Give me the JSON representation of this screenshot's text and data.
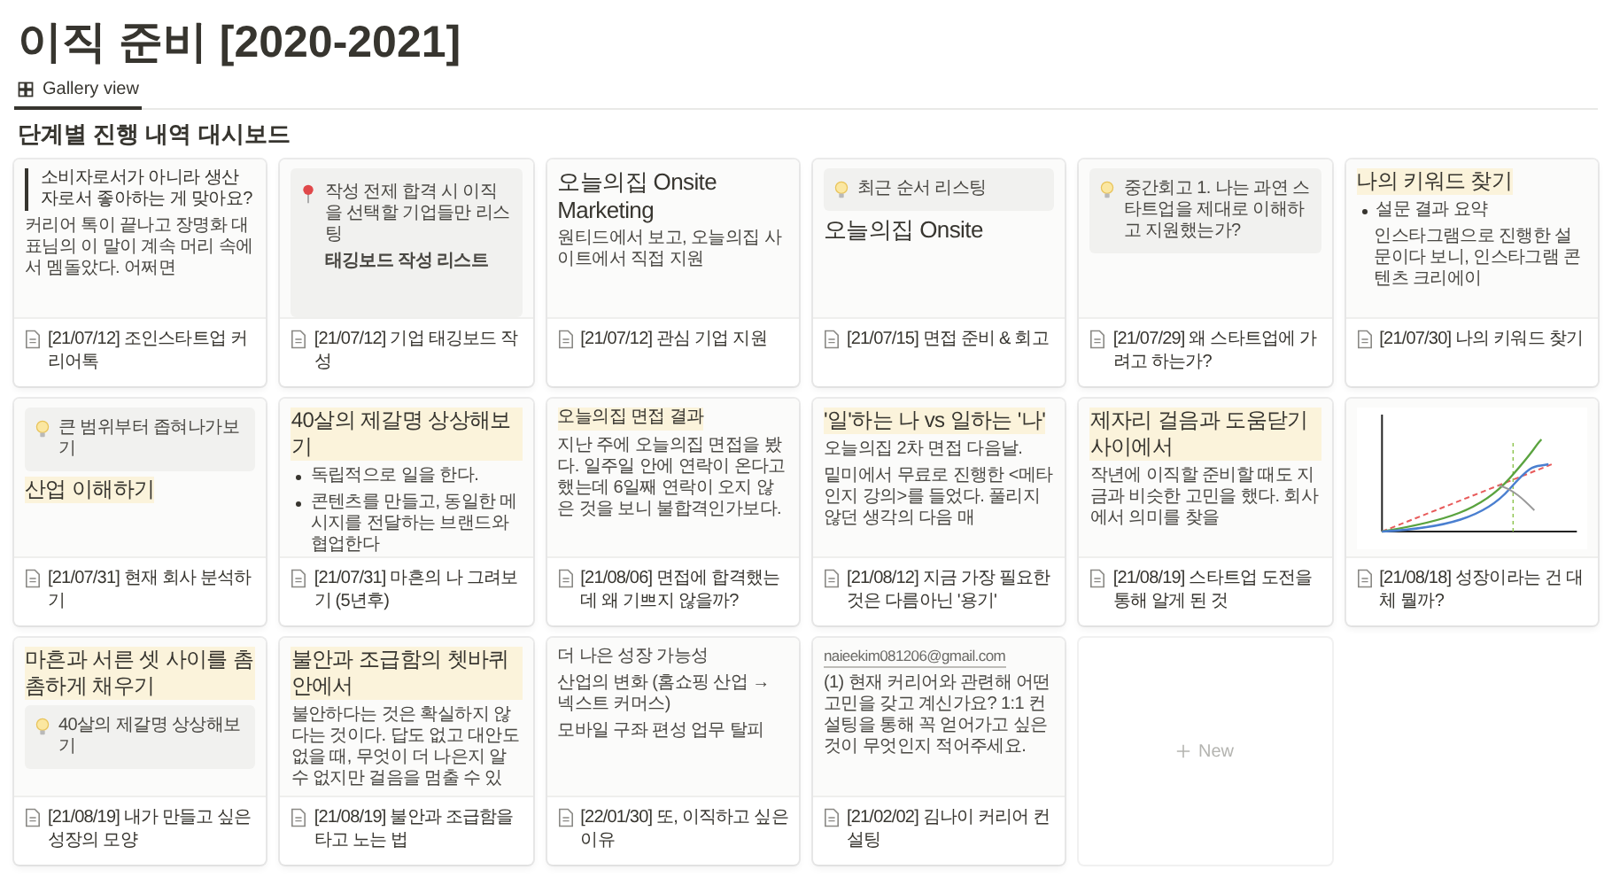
{
  "page": {
    "title": "이직 준비 [2020-2021]"
  },
  "views": [
    {
      "label": "Gallery view",
      "selected": true
    }
  ],
  "section_title": "단계별 진행 내역 대시보드",
  "cards": [
    {
      "title": "[21/07/12] 조인스타트업 커리어톡",
      "preview": [
        {
          "kind": "quote",
          "text": "소비자로서가 아니라 생산자로서 좋아하는 게 맞아요?"
        },
        {
          "kind": "para",
          "text": "커리어 톡이 끝나고 장명화 대표님의 이 말이 계속 머리 속에서 멤돌았다. 어쩌면"
        }
      ]
    },
    {
      "title": "[21/07/12] 기업 태깅보드 작성",
      "preview": [
        {
          "kind": "notice",
          "text": "작성 전제 합격 시 이직을 선택할 기업들만 리스팅",
          "subtext": "태깅보드 작성 리스트"
        }
      ]
    },
    {
      "title": "[21/07/12] 관심 기업 지원",
      "preview": [
        {
          "kind": "title",
          "text": "오늘의집 Onsite Marketing"
        },
        {
          "kind": "para",
          "text": "원티드에서 보고, 오늘의집 사이트에서 직접 지원"
        }
      ]
    },
    {
      "title": "[21/07/15] 면접 준비 & 회고",
      "preview": [
        {
          "kind": "callout",
          "text": "최근 순서 리스팅"
        },
        {
          "kind": "title",
          "text": "오늘의집 Onsite"
        }
      ]
    },
    {
      "title": "[21/07/29] 왜 스타트업에 가려고 하는가?",
      "preview": [
        {
          "kind": "callout",
          "text": "중간회고 1. 나는 과연 스타트업을 제대로 이해하고 지원했는가?"
        }
      ]
    },
    {
      "title": "[21/07/30] 나의 키워드 찾기",
      "preview": [
        {
          "kind": "heading",
          "text": "나의 키워드 찾기",
          "highlighted": true
        },
        {
          "kind": "bullet",
          "text": "설문 결과 요약"
        },
        {
          "kind": "indent",
          "text": "인스타그램으로 진행한 설문이다 보니, 인스타그램 콘텐츠 크리에이"
        }
      ]
    },
    {
      "title": "[21/07/31] 현재 회사 분석하기",
      "preview": [
        {
          "kind": "callout",
          "text": "큰 범위부터 좁혀나가보기"
        },
        {
          "kind": "heading",
          "text": "산업 이해하기",
          "highlighted": true
        }
      ]
    },
    {
      "title": "[21/07/31] 마흔의 나 그려보기 (5년후)",
      "preview": [
        {
          "kind": "heading",
          "text": "40살의 제갈명 상상해보기",
          "highlighted": true
        },
        {
          "kind": "bullet",
          "text": "독립적으로 일을 한다."
        },
        {
          "kind": "bullet",
          "text": "콘텐츠를 만들고, 동일한 메시지를 전달하는 브랜드와 협업한다"
        }
      ]
    },
    {
      "title": "[21/08/06] 면접에 합격했는데 왜 기쁘지 않을까?",
      "preview": [
        {
          "kind": "subheading",
          "text": "오늘의집 면접 결과",
          "highlighted": true
        },
        {
          "kind": "para",
          "text": "지난 주에 오늘의집 면접을 봤다. 일주일 안에 연락이 온다고 했는데 6일째 연락이 오지 않은 것을 보니 불합격인가보다."
        }
      ]
    },
    {
      "title": "[21/08/12] 지금 가장 필요한 것은 다름아닌 '용기'",
      "preview": [
        {
          "kind": "heading",
          "text": "'일'하는 나 vs 일하는 '나'",
          "highlighted": true
        },
        {
          "kind": "para",
          "text": "오늘의집 2차 면접 다음날."
        },
        {
          "kind": "para",
          "text": "밑미에서 무료로 진행한 <메타인지 강의>를 들었다. 풀리지 않던 생각의 다음 매"
        }
      ]
    },
    {
      "title": "[21/08/19] 스타트업 도전을 통해 알게 된 것",
      "preview": [
        {
          "kind": "heading",
          "text": "제자리 걸음과 도움닫기 사이에서",
          "highlighted": true
        },
        {
          "kind": "para",
          "text": "작년에 이직할 준비할 때도 지금과 비슷한 고민을 했다. 회사에서 의미를 찾을"
        }
      ]
    },
    {
      "title": "[21/08/18] 성장이라는 건 대체 뭘까?",
      "preview": [
        {
          "kind": "image"
        }
      ]
    },
    {
      "title": "[21/08/19] 내가 만들고 싶은 성장의 모양",
      "preview": [
        {
          "kind": "heading",
          "text": "마흔과 서른 셋 사이를 촘촘하게 채우기",
          "highlighted": true
        },
        {
          "kind": "callout",
          "text": "40살의 제갈명 상상해보기"
        }
      ]
    },
    {
      "title": "[21/08/19] 불안과 조급함을 타고 노는 법",
      "preview": [
        {
          "kind": "heading",
          "text": "불안과 조급함의 쳇바퀴 안에서",
          "highlighted": true
        },
        {
          "kind": "para",
          "text": "불안하다는 것은 확실하지 않다는 것이다. 답도 없고 대안도 없을 때, 무엇이 더 나은지 알 수 없지만 걸음을 멈출 수 있"
        }
      ]
    },
    {
      "title": "[22/01/30] 또, 이직하고 싶은 이유",
      "preview": [
        {
          "kind": "para",
          "text": "더 나은 성장 가능성"
        },
        {
          "kind": "para",
          "text": "산업의 변화 (홈쇼핑 산업 → 넥스트 커머스)"
        },
        {
          "kind": "para",
          "text": "모바일 구좌 편성 업무 탈피"
        }
      ]
    },
    {
      "title": "[21/02/02] 김나이 커리어 컨설팅",
      "preview": [
        {
          "kind": "link",
          "text": "naieekim081206@gmail.com"
        },
        {
          "kind": "para",
          "text": "(1) 현재 커리어와 관련해 어떤 고민을 갖고 계신가요? 1:1 컨설팅을 통해 꼭 얻어가고 싶은 것이 무엇인지 적어주세요."
        }
      ]
    }
  ],
  "new_card": {
    "label": "New"
  }
}
